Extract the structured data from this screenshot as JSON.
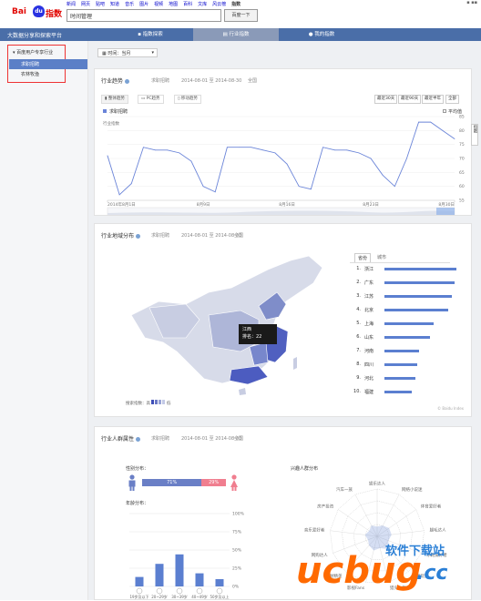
{
  "header": {
    "logo": {
      "bai": "Bai",
      "du": "du",
      "zs": "指数"
    },
    "topnav": [
      "新闻",
      "网页",
      "贴吧",
      "知道",
      "音乐",
      "图片",
      "视频",
      "地图",
      "百科",
      "文库",
      "风云榜",
      "指数"
    ],
    "topnav_current": "指数",
    "topright": "▪ ▪▪",
    "search_value": "时间管理",
    "search_button": "百度一下"
  },
  "navbar": {
    "brand": "大数据分享和探索平台",
    "tabs": [
      "指数探索",
      "行业指数",
      "我的指数"
    ]
  },
  "sidebar": {
    "group": "▾ 百度用户专享行业",
    "items": [
      "求职招聘",
      "农林牧渔"
    ]
  },
  "toolbar": {
    "time": "时间：当月"
  },
  "trend": {
    "title": "行业趋势",
    "meta": [
      "求职招聘",
      "2014-08-01 至 2014-08-30",
      "全国"
    ],
    "tabs": [
      "整体趋势",
      "PC趋势",
      "移动趋势"
    ],
    "ranges": [
      "最近30天",
      "最近90天",
      "最近半年",
      "全部"
    ],
    "legend": "求职招聘",
    "avg": "平均值",
    "ylabel": "行业指数",
    "side_label": "指数"
  },
  "chart_data": {
    "type": "line",
    "x": [
      "2014-08-01",
      "2014-08-02",
      "2014-08-03",
      "2014-08-04",
      "2014-08-05",
      "2014-08-06",
      "2014-08-07",
      "2014-08-08",
      "2014-08-09",
      "2014-08-10",
      "2014-08-11",
      "2014-08-12",
      "2014-08-13",
      "2014-08-14",
      "2014-08-15",
      "2014-08-16",
      "2014-08-17",
      "2014-08-18",
      "2014-08-19",
      "2014-08-20",
      "2014-08-21",
      "2014-08-22",
      "2014-08-23",
      "2014-08-24",
      "2014-08-25",
      "2014-08-26",
      "2014-08-27",
      "2014-08-28",
      "2014-08-29",
      "2014-08-30"
    ],
    "series": [
      {
        "name": "求职招聘",
        "values": [
          71,
          57,
          61,
          74,
          73,
          73,
          72,
          69,
          60,
          58,
          74,
          74,
          74,
          73,
          72,
          68,
          60,
          59,
          74,
          73,
          73,
          72,
          70,
          64,
          60,
          70,
          83,
          83,
          80,
          77
        ]
      }
    ],
    "xticks": [
      "2014年8月1日",
      "8月9日",
      "8月16日",
      "8月23日",
      "8月30日"
    ],
    "yticks": [
      "85",
      "80",
      "75",
      "70",
      "65",
      "60",
      "55"
    ],
    "ylim": [
      55,
      85
    ],
    "ylabel": "行业指数",
    "overview_years": [
      "2013",
      "2014"
    ]
  },
  "region": {
    "title": "行业地域分布",
    "meta": [
      "求职招聘",
      "2014-08-01 至 2014-08-30",
      "全国"
    ],
    "tooltip_name": "江西",
    "tooltip_rank": "排名：22",
    "scale_label": "搜索指数：高",
    "scale_low": "低",
    "rank_tabs": [
      "省份",
      "城市"
    ],
    "ranks": [
      {
        "n": "1.",
        "name": "浙江",
        "pct": 0.88
      },
      {
        "n": "2.",
        "name": "广东",
        "pct": 0.86
      },
      {
        "n": "3.",
        "name": "江苏",
        "pct": 0.82
      },
      {
        "n": "4.",
        "name": "北京",
        "pct": 0.78
      },
      {
        "n": "5.",
        "name": "上海",
        "pct": 0.6
      },
      {
        "n": "6.",
        "name": "山东",
        "pct": 0.55
      },
      {
        "n": "7.",
        "name": "河南",
        "pct": 0.42
      },
      {
        "n": "8.",
        "name": "四川",
        "pct": 0.4
      },
      {
        "n": "9.",
        "name": "河北",
        "pct": 0.38
      },
      {
        "n": "10.",
        "name": "福建",
        "pct": 0.33
      }
    ],
    "credit": "© Baidu Index"
  },
  "crowd": {
    "title": "行业人群属性",
    "meta": [
      "求职招聘",
      "2014-08-01 至 2014-08-30",
      "全国"
    ],
    "gender_title": "性别分布：",
    "male_pct": "71%",
    "female_pct": "29%",
    "male_share": 0.71,
    "age_title": "年龄分布：",
    "age_yticks": [
      "100%",
      "75%",
      "50%",
      "25%",
      "0%"
    ],
    "age_labels": [
      "19岁及以下",
      "20~29岁",
      "30~39岁",
      "40~49岁",
      "50岁及以上"
    ],
    "age_values": [
      0.13,
      0.31,
      0.44,
      0.18,
      0.1
    ],
    "interest_title": "兴趣人群分布",
    "interests": [
      "娱乐达人",
      "网络小说迷",
      "体育爱好者",
      "腿毛达人",
      "乐跑爱好者",
      "游戏玩家",
      "猎头一族",
      "影视Fans",
      "理财精英",
      "网购达人",
      "音乐爱好者",
      "房产投资",
      "汽车一族"
    ]
  },
  "watermark": {
    "text1": "ucbug",
    "text2": ".cc",
    "text3": "软件下载站"
  },
  "colors": {
    "nav": "#4a6ea8",
    "line": "#6a84d8",
    "bar": "#5b7fd0",
    "male": "#6a7fc6",
    "female": "#f07e8f",
    "select": "#5b7fc7",
    "highlight_box": "#e33"
  }
}
